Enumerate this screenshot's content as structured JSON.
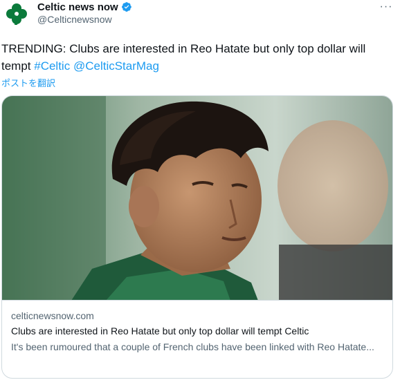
{
  "account": {
    "display_name": "Celtic news now",
    "handle": "@Celticnewsnow",
    "verified": true,
    "avatar_icon": "shamrock-icon",
    "avatar_color": "#0b7a3b"
  },
  "more_icon": "more-dots-icon",
  "tweet": {
    "text_prefix": "TRENDING: Clubs are interested in Reo Hatate but only top dollar will tempt ",
    "hashtag": "#Celtic",
    "mention": "@CelticStarMag",
    "translate_label": "ポストを翻訳",
    "link_color": "#1d9bf0"
  },
  "card": {
    "domain": "celticnewsnow.com",
    "title": "Clubs are interested in Reo Hatate but only top dollar will tempt Celtic",
    "description": "It's been rumoured that a couple of French clubs have been linked with Reo Hatate..."
  }
}
